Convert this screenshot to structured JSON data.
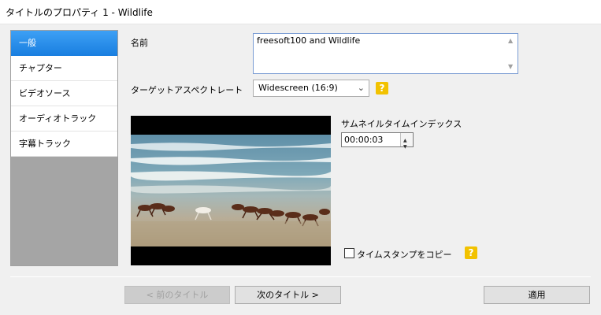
{
  "window": {
    "title": "タイトルのプロパティ 1 - Wildlife"
  },
  "sidebar": {
    "items": [
      {
        "label": "一般",
        "active": true
      },
      {
        "label": "チャプター"
      },
      {
        "label": "ビデオソース"
      },
      {
        "label": "オーディオトラック"
      },
      {
        "label": "字幕トラック"
      }
    ]
  },
  "form": {
    "name_label": "名前",
    "name_value": "freesoft100 and Wildlife",
    "aspect_label": "ターゲットアスペクトレート",
    "aspect_value": "Widescreen (16:9)",
    "help_glyph": "?",
    "thumb_label": "サムネイルタイムインデックス",
    "thumb_value": "00:00:03",
    "copy_timestamp_label": "タイムスタンプをコピー",
    "copy_timestamp_checked": false
  },
  "buttons": {
    "prev": "< 前のタイトル",
    "next": "次のタイトル >",
    "apply": "適用"
  },
  "colors": {
    "accent": "#1a7fe0",
    "help": "#f2c200"
  }
}
